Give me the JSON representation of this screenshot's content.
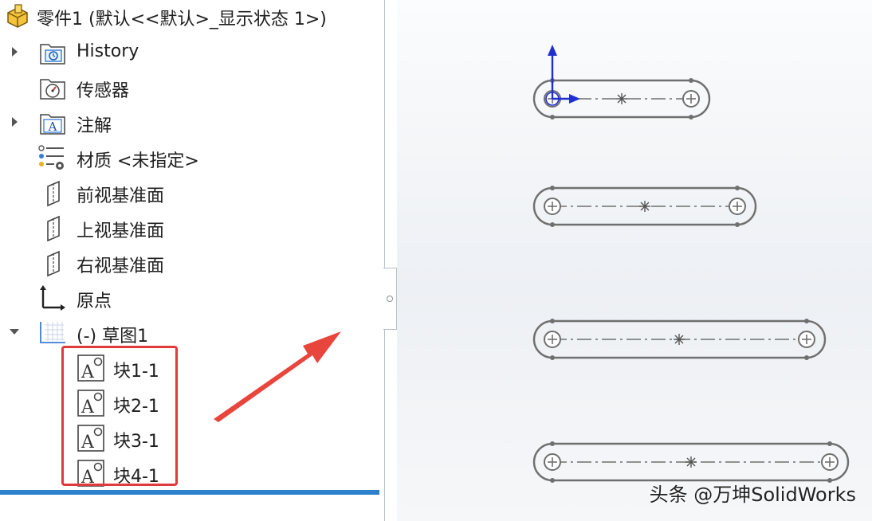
{
  "tree": {
    "root_label": "零件1 (默认<<默认>_显示状态 1>)",
    "items": [
      {
        "label": "History",
        "icon": "history-folder-icon",
        "expand": "right"
      },
      {
        "label": "传感器",
        "icon": "sensor-folder-icon",
        "expand": ""
      },
      {
        "label": "注解",
        "icon": "annotation-folder-icon",
        "expand": "right"
      },
      {
        "label": "材质 <未指定>",
        "icon": "material-icon",
        "expand": ""
      },
      {
        "label": "前视基准面",
        "icon": "plane-icon",
        "expand": ""
      },
      {
        "label": "上视基准面",
        "icon": "plane-icon",
        "expand": ""
      },
      {
        "label": "右视基准面",
        "icon": "plane-icon",
        "expand": ""
      },
      {
        "label": "原点",
        "icon": "origin-icon",
        "expand": ""
      },
      {
        "label": "(-) 草图1",
        "icon": "sketch-icon",
        "expand": "down"
      }
    ],
    "blocks": [
      {
        "label": "块1-1",
        "icon": "block-icon"
      },
      {
        "label": "块2-1",
        "icon": "block-icon"
      },
      {
        "label": "块3-1",
        "icon": "block-icon"
      },
      {
        "label": "块4-1",
        "icon": "block-icon"
      }
    ]
  },
  "watermark": "头条 @万坤SolidWorks",
  "colors": {
    "highlight": "#e03a3a",
    "arrow": "#e8453c",
    "axis": "#1f2ecf",
    "sketch_line": "#6f6f6f",
    "selection_bar": "#2e7fcc"
  }
}
